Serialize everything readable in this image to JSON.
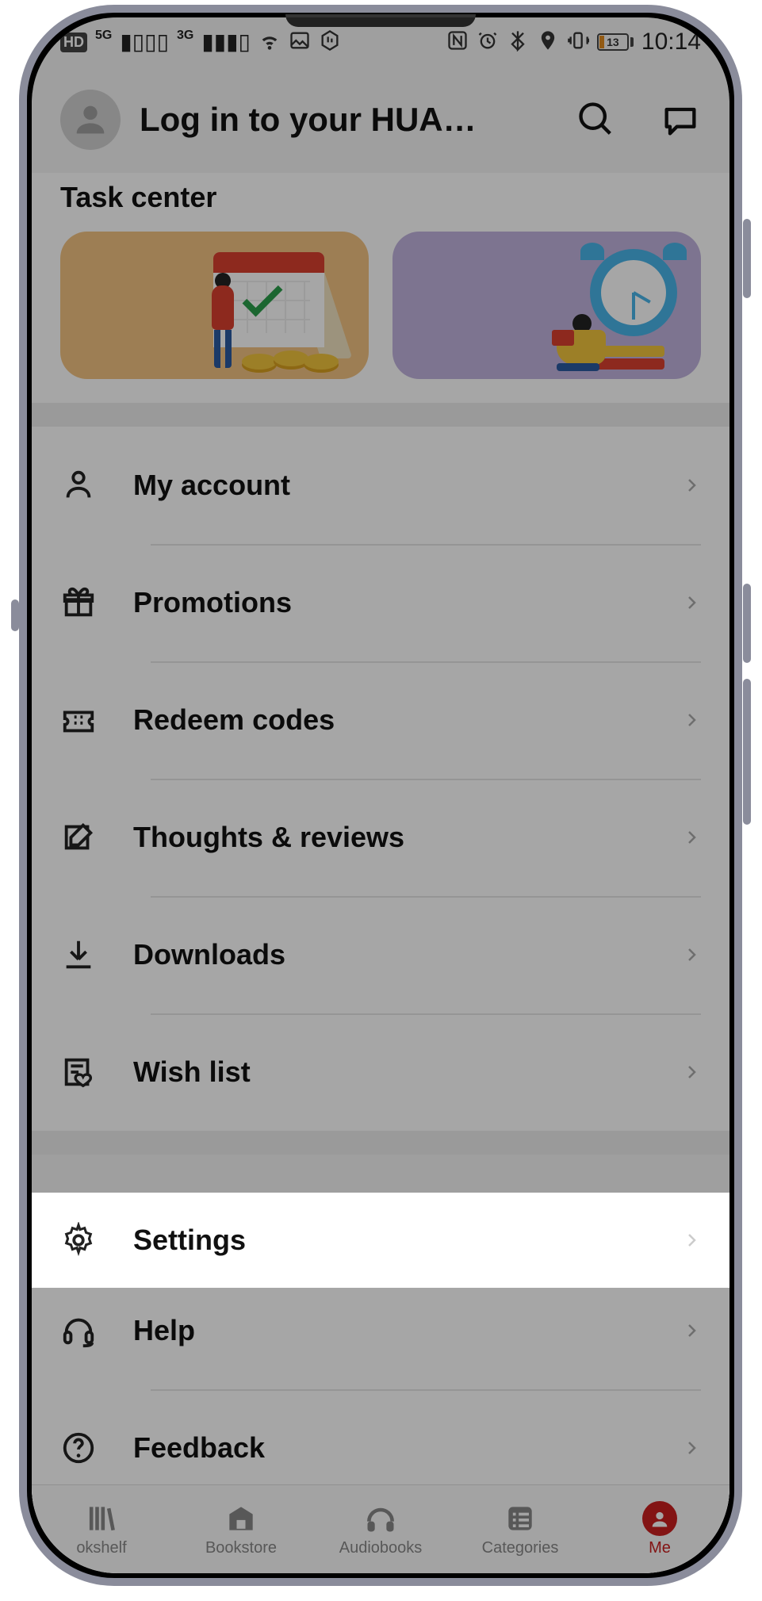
{
  "statusbar": {
    "hd": "HD",
    "sig1": "5G",
    "sig2": "3G",
    "battery_pct": "13",
    "time": "10:14"
  },
  "header": {
    "login_text": "Log in to your HUA…"
  },
  "task": {
    "title": "Task center"
  },
  "menu": {
    "items": [
      {
        "label": "My account",
        "icon": "person"
      },
      {
        "label": "Promotions",
        "icon": "gift"
      },
      {
        "label": "Redeem codes",
        "icon": "ticket"
      },
      {
        "label": "Thoughts & reviews",
        "icon": "edit"
      },
      {
        "label": "Downloads",
        "icon": "download"
      },
      {
        "label": "Wish list",
        "icon": "heart-list"
      }
    ],
    "settings_label": "Settings",
    "items2": [
      {
        "label": "Help",
        "icon": "headset"
      },
      {
        "label": "Feedback",
        "icon": "question"
      }
    ]
  },
  "bottomnav": {
    "items": [
      {
        "label": "okshelf"
      },
      {
        "label": "Bookstore"
      },
      {
        "label": "Audiobooks"
      },
      {
        "label": "Categories"
      },
      {
        "label": "Me"
      }
    ]
  }
}
